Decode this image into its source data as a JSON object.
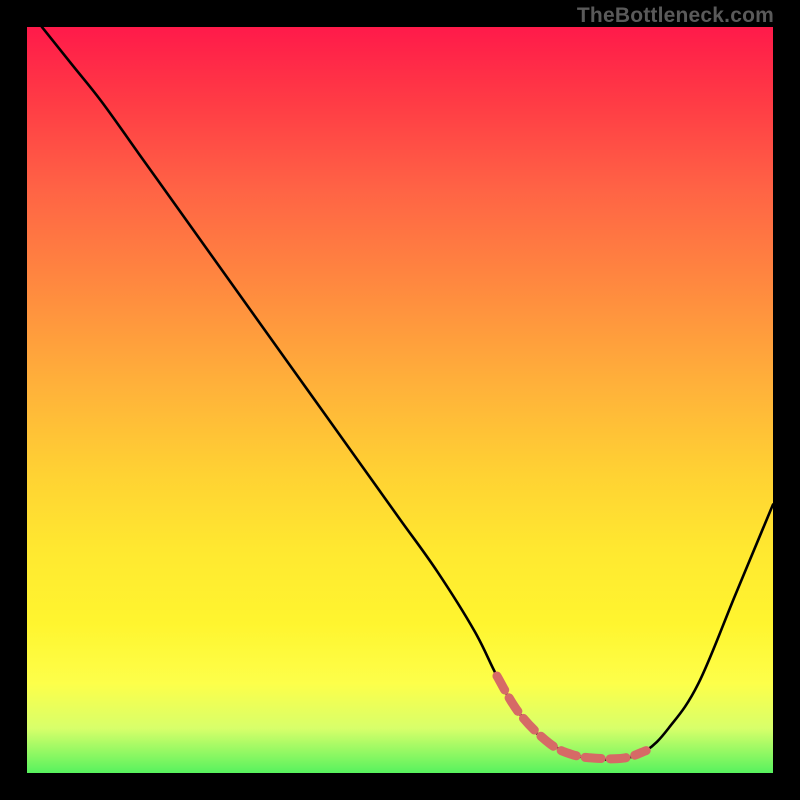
{
  "watermark": "TheBottleneck.com",
  "chart_data": {
    "type": "line",
    "title": "",
    "xlabel": "",
    "ylabel": "",
    "xlim": [
      0,
      100
    ],
    "ylim": [
      0,
      100
    ],
    "series": [
      {
        "name": "curve",
        "color": "#000000",
        "x": [
          2,
          6,
          10,
          15,
          20,
          25,
          30,
          35,
          40,
          45,
          50,
          55,
          60,
          63,
          66,
          70,
          75,
          80,
          83,
          86,
          90,
          95,
          100
        ],
        "y": [
          100,
          95,
          90,
          83,
          76,
          69,
          62,
          55,
          48,
          41,
          34,
          27,
          19,
          13,
          8,
          4,
          2,
          2,
          3,
          6,
          12,
          24,
          36
        ]
      },
      {
        "name": "highlight",
        "color": "#d66a66",
        "x": [
          63,
          66,
          70,
          73,
          76,
          80,
          83
        ],
        "y": [
          13,
          8,
          4,
          2.5,
          2,
          2,
          3
        ]
      }
    ]
  }
}
